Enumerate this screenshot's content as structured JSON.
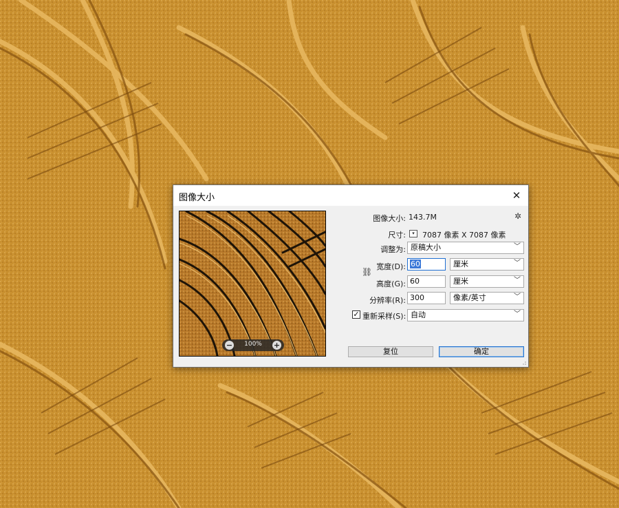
{
  "dialog": {
    "title": "图像大小",
    "close_glyph": "✕",
    "image_size_label": "图像大小:",
    "image_size_value": "143.7M",
    "dimensions_label": "尺寸:",
    "dimensions_value": "7087 像素  X  7087 像素",
    "fit_to_label": "调整为:",
    "fit_to_value": "原稿大小",
    "width_label": "宽度(D):",
    "width_value": "60",
    "width_unit": "厘米",
    "height_label": "高度(G):",
    "height_value": "60",
    "height_unit": "厘米",
    "resolution_label": "分辨率(R):",
    "resolution_value": "300",
    "resolution_unit": "像素/英寸",
    "resample_label": "重新采样(S):",
    "resample_checked": true,
    "resample_value": "自动",
    "reset_button": "复位",
    "ok_button": "确定",
    "zoom_level": "100%"
  },
  "icons": {
    "close": "close-icon",
    "gear": "gear-icon",
    "chain": "chain-link-icon",
    "zoom_out": "zoom-out-icon",
    "zoom_in": "zoom-in-icon",
    "dropdown": "chevron-down-icon"
  }
}
